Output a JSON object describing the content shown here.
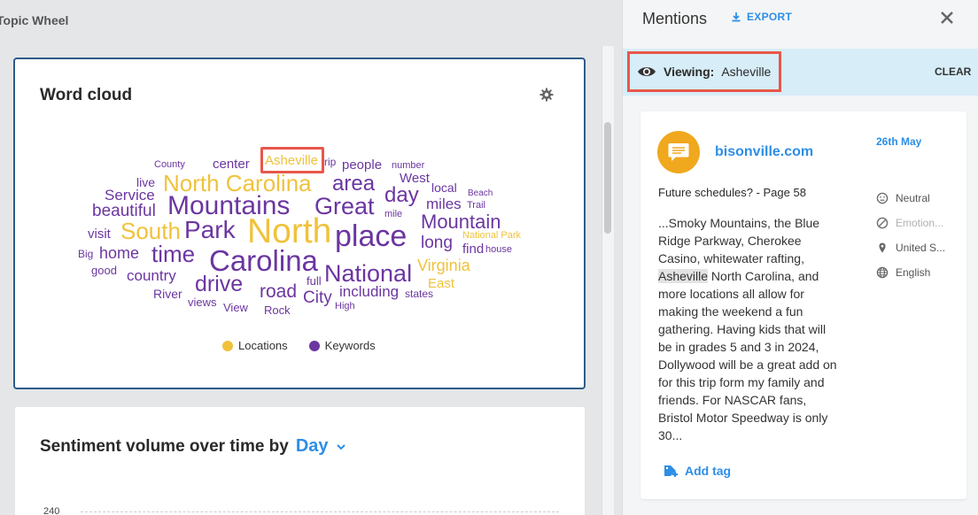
{
  "page": {
    "title": "Topic Wheel"
  },
  "word_cloud": {
    "title": "Word cloud",
    "highlighted_word": "Asheville",
    "words": [
      {
        "text": "County",
        "type": "keyword"
      },
      {
        "text": "center",
        "type": "keyword"
      },
      {
        "text": "Asheville",
        "type": "location"
      },
      {
        "text": "rip",
        "type": "keyword"
      },
      {
        "text": "people",
        "type": "keyword"
      },
      {
        "text": "number",
        "type": "keyword"
      },
      {
        "text": "live",
        "type": "keyword"
      },
      {
        "text": "North Carolina",
        "type": "location"
      },
      {
        "text": "area",
        "type": "keyword"
      },
      {
        "text": "West",
        "type": "keyword"
      },
      {
        "text": "local",
        "type": "keyword"
      },
      {
        "text": "Service",
        "type": "keyword"
      },
      {
        "text": "day",
        "type": "keyword"
      },
      {
        "text": "Beach",
        "type": "keyword"
      },
      {
        "text": "beautiful",
        "type": "keyword"
      },
      {
        "text": "Mountains",
        "type": "keyword"
      },
      {
        "text": "Great",
        "type": "keyword"
      },
      {
        "text": "miles",
        "type": "keyword"
      },
      {
        "text": "Trail",
        "type": "keyword"
      },
      {
        "text": "mile",
        "type": "keyword"
      },
      {
        "text": "Mountain",
        "type": "keyword"
      },
      {
        "text": "visit",
        "type": "keyword"
      },
      {
        "text": "South",
        "type": "location"
      },
      {
        "text": "Park",
        "type": "keyword"
      },
      {
        "text": "North",
        "type": "location"
      },
      {
        "text": "place",
        "type": "keyword"
      },
      {
        "text": "long",
        "type": "keyword"
      },
      {
        "text": "National Park",
        "type": "location"
      },
      {
        "text": "Big",
        "type": "keyword"
      },
      {
        "text": "home",
        "type": "keyword"
      },
      {
        "text": "time",
        "type": "keyword"
      },
      {
        "text": "Carolina",
        "type": "keyword"
      },
      {
        "text": "find",
        "type": "keyword"
      },
      {
        "text": "house",
        "type": "keyword"
      },
      {
        "text": "good",
        "type": "keyword"
      },
      {
        "text": "Virginia",
        "type": "location"
      },
      {
        "text": "country",
        "type": "keyword"
      },
      {
        "text": "National",
        "type": "keyword"
      },
      {
        "text": "drive",
        "type": "keyword"
      },
      {
        "text": "full",
        "type": "keyword"
      },
      {
        "text": "East",
        "type": "location"
      },
      {
        "text": "River",
        "type": "keyword"
      },
      {
        "text": "road",
        "type": "keyword"
      },
      {
        "text": "including",
        "type": "keyword"
      },
      {
        "text": "states",
        "type": "keyword"
      },
      {
        "text": "City",
        "type": "keyword"
      },
      {
        "text": "views",
        "type": "keyword"
      },
      {
        "text": "View",
        "type": "keyword"
      },
      {
        "text": "Rock",
        "type": "keyword"
      },
      {
        "text": "High",
        "type": "keyword"
      }
    ],
    "legend": [
      {
        "label": "Locations",
        "color": "#f0c23c"
      },
      {
        "label": "Keywords",
        "color": "#6b36a0"
      }
    ]
  },
  "sentiment": {
    "title": "Sentiment volume over time by",
    "period": "Day",
    "y_tick": "240"
  },
  "mentions": {
    "title": "Mentions",
    "export_label": "EXPORT",
    "viewing_label": "Viewing:",
    "viewing_value": "Asheville",
    "clear_label": "CLEAR",
    "item": {
      "source": "bisonville.com",
      "date": "26th May",
      "title": "Future schedules? - Page 58",
      "body_before": "...Smoky Mountains, the Blue Ridge Parkway, Cherokee Casino, whitewater rafting, ",
      "body_highlight": "Asheville",
      "body_after": " North Carolina, and more locations all allow for making the weekend a fun gathering. Having kids that will be in grades 5 and 3 in 2024, Dollywood will be a great add on for this trip form my family and friends. For NASCAR fans, Bristol Motor Speedway is only 30...",
      "sentiment": "Neutral",
      "emotion": "Emotion...",
      "location": "United S...",
      "language": "English",
      "add_tag_label": "Add tag"
    }
  }
}
